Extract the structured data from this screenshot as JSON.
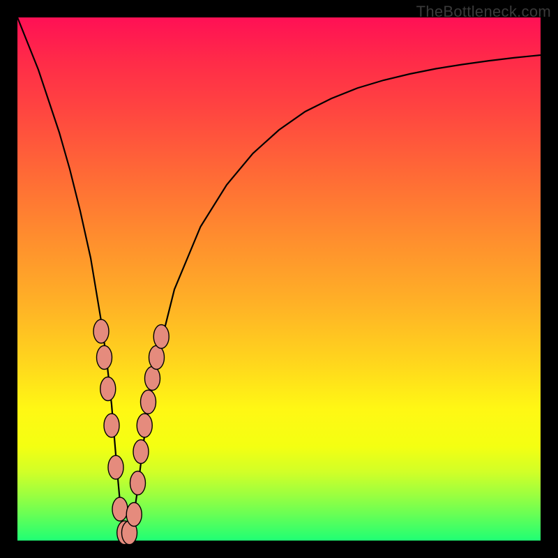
{
  "watermark": "TheBottleneck.com",
  "colors": {
    "curve": "#000000",
    "marker_fill": "#e58b7d",
    "marker_stroke": "#000000"
  },
  "chart_data": {
    "type": "line",
    "title": "",
    "xlabel": "",
    "ylabel": "",
    "xlim": [
      0,
      100
    ],
    "ylim": [
      0,
      100
    ],
    "grid": false,
    "series": [
      {
        "name": "bottleneck-curve",
        "x": [
          0,
          2,
          4,
          6,
          8,
          10,
          12,
          14,
          16,
          17,
          18,
          19,
          20,
          21,
          22,
          23,
          24,
          25,
          27,
          30,
          35,
          40,
          45,
          50,
          55,
          60,
          65,
          70,
          75,
          80,
          85,
          90,
          95,
          100
        ],
        "values": [
          100,
          95,
          90,
          84,
          78,
          71,
          63,
          54,
          42,
          35,
          26,
          14,
          3,
          1,
          3,
          10,
          18,
          25,
          36,
          48,
          60,
          68,
          74,
          78.5,
          82,
          84.5,
          86.5,
          88,
          89.2,
          90.2,
          91,
          91.7,
          92.3,
          92.8
        ]
      }
    ],
    "markers": [
      {
        "x": 16.0,
        "y": 40.0
      },
      {
        "x": 16.6,
        "y": 35.0
      },
      {
        "x": 17.3,
        "y": 29.0
      },
      {
        "x": 18.0,
        "y": 22.0
      },
      {
        "x": 18.8,
        "y": 14.0
      },
      {
        "x": 19.6,
        "y": 6.0
      },
      {
        "x": 20.5,
        "y": 1.5
      },
      {
        "x": 21.4,
        "y": 1.5
      },
      {
        "x": 22.3,
        "y": 5.0
      },
      {
        "x": 23.0,
        "y": 11.0
      },
      {
        "x": 23.6,
        "y": 17.0
      },
      {
        "x": 24.3,
        "y": 22.0
      },
      {
        "x": 25.0,
        "y": 26.5
      },
      {
        "x": 25.8,
        "y": 31.0
      },
      {
        "x": 26.6,
        "y": 35.0
      },
      {
        "x": 27.5,
        "y": 39.0
      }
    ]
  }
}
